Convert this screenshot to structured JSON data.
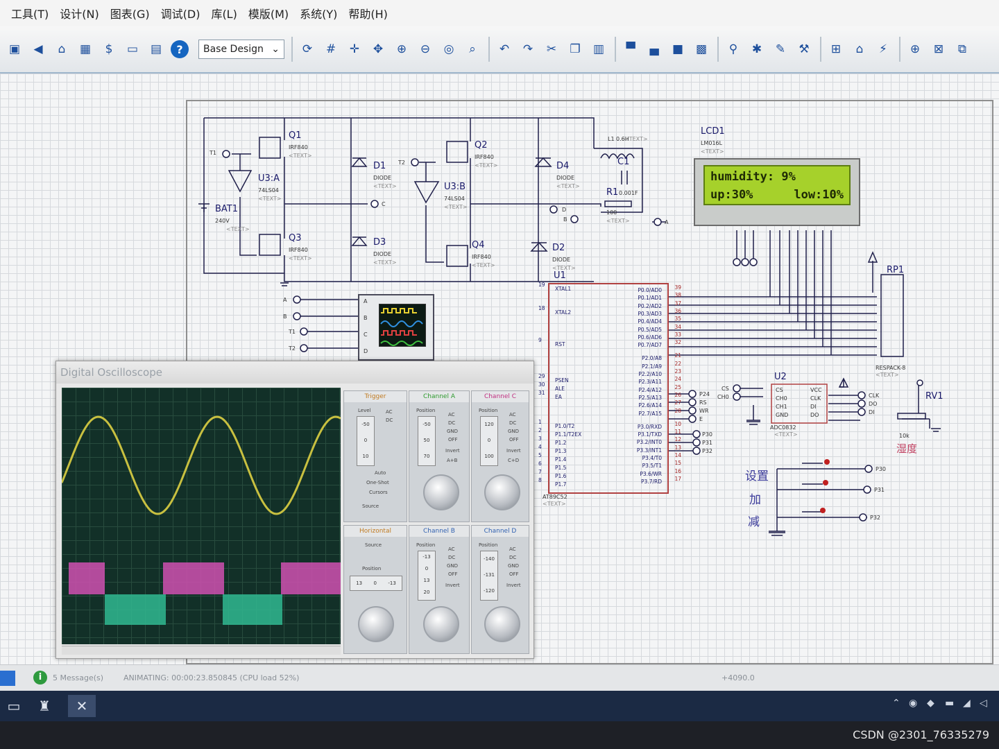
{
  "menu": {
    "items": [
      "工具(T)",
      "设计(N)",
      "图表(G)",
      "调试(D)",
      "库(L)",
      "模版(M)",
      "系统(Y)",
      "帮助(H)"
    ]
  },
  "toolbar": {
    "design_select": "Base Design",
    "icons": [
      "chip-icon",
      "back-icon",
      "component-icon",
      "pcb-icon",
      "bom-icon",
      "netlist-icon",
      "file-icon",
      "help-icon",
      "refresh-icon",
      "grid-icon",
      "origin-icon",
      "pan-icon",
      "zoom-in-icon",
      "zoom-out-icon",
      "zoom-all-icon",
      "zoom-area-icon",
      "undo-icon",
      "redo-icon",
      "cut-icon",
      "copy-icon",
      "paste-icon",
      "block-copy-icon",
      "block-move-icon",
      "block-rotate-icon",
      "block-delete-icon",
      "pick-icon",
      "make-device-icon",
      "packaging-icon",
      "decompose-icon",
      "wire-autorouter-icon",
      "search-icon",
      "property-icon",
      "new-sheet-icon",
      "remove-sheet-icon",
      "parent-sheet-icon"
    ]
  },
  "schematic": {
    "q1": {
      "name": "Q1",
      "part": "IRF840",
      "text": "<TEXT>"
    },
    "q2": {
      "name": "Q2",
      "part": "IRF840",
      "text": "<TEXT>"
    },
    "q3": {
      "name": "Q3",
      "part": "IRF840",
      "text": "<TEXT>"
    },
    "q4": {
      "name": "Q4",
      "part": "IRF840",
      "text": "<TEXT>"
    },
    "d1": {
      "name": "D1",
      "part": "DIODE",
      "text": "<TEXT>"
    },
    "d2": {
      "name": "D2",
      "part": "DIODE",
      "text": "<TEXT>"
    },
    "d3": {
      "name": "D3",
      "part": "DIODE",
      "text": "<TEXT>"
    },
    "d4": {
      "name": "D4",
      "part": "DIODE",
      "text": "<TEXT>"
    },
    "u3a": {
      "name": "U3:A",
      "part": "74LS04",
      "text": "<TEXT>"
    },
    "u3b": {
      "name": "U3:B",
      "part": "74LS04",
      "text": "<TEXT>"
    },
    "bat": {
      "name": "BAT1",
      "value": "240V",
      "text": "<TEXT>"
    },
    "l1": {
      "name": "L1",
      "value": "0.6H",
      "text": "<TEXT>"
    },
    "c1": {
      "name": "C1",
      "value": "0.001F"
    },
    "r1": {
      "name": "R1",
      "value": "100",
      "text": "<TEXT>"
    },
    "terminals": {
      "t1": "T1",
      "t2": "T2",
      "a": "A",
      "b": "B",
      "c": "C",
      "d": "D"
    },
    "scope_inputs": [
      "A",
      "B",
      "T1",
      "T2"
    ],
    "scope_channels": [
      "A",
      "B",
      "C",
      "D"
    ],
    "lcd": {
      "name": "LCD1",
      "part": "LM016L",
      "text": "<TEXT>",
      "line1": "humidity: 9%",
      "line2_left": "up:30%",
      "line2_right": "low:10%"
    },
    "u1": {
      "name": "U1",
      "part": "AT89C52",
      "text": "<TEXT>",
      "left_pins": [
        "XTAL1",
        "XTAL2",
        "RST",
        "PSEN",
        "ALE",
        "EA",
        "P1.0/T2",
        "P1.1/T2EX",
        "P1.2",
        "P1.3",
        "P1.4",
        "P1.5",
        "P1.6",
        "P1.7"
      ],
      "left_numbers": [
        "19",
        "18",
        "9",
        "29",
        "30",
        "31",
        "1",
        "2",
        "3",
        "4",
        "5",
        "6",
        "7",
        "8"
      ],
      "right_pins": [
        "P0.0/AD0",
        "P0.1/AD1",
        "P0.2/AD2",
        "P0.3/AD3",
        "P0.4/AD4",
        "P0.5/AD5",
        "P0.6/AD6",
        "P0.7/AD7",
        "P2.0/A8",
        "P2.1/A9",
        "P2.2/A10",
        "P2.3/A11",
        "P2.4/A12",
        "P2.5/A13",
        "P2.6/A14",
        "P2.7/A15",
        "P3.0/RXD",
        "P3.1/TXD",
        "P3.2/INT0",
        "P3.3/INT1",
        "P3.4/T0",
        "P3.5/T1",
        "P3.6/WR",
        "P3.7/RD"
      ],
      "right_numbers": [
        "39",
        "38",
        "37",
        "36",
        "35",
        "34",
        "33",
        "32",
        "21",
        "22",
        "23",
        "24",
        "25",
        "26",
        "27",
        "28",
        "10",
        "11",
        "12",
        "13",
        "14",
        "15",
        "16",
        "17"
      ]
    },
    "rp1": {
      "name": "RP1",
      "part": "RESPACK-8",
      "text": "<TEXT>"
    },
    "u2": {
      "name": "U2",
      "part": "ADC0832",
      "text": "<TEXT>",
      "left_pins": [
        "CS",
        "CH0",
        "CH1",
        "GND"
      ],
      "right_pins": [
        "VCC",
        "CLK",
        "DI",
        "DO"
      ],
      "net_left": [
        "CS",
        "CH0"
      ],
      "net_right": [
        "CLK",
        "DO",
        "DI"
      ]
    },
    "adc_nets": [
      "P24",
      "RS",
      "WR",
      "E"
    ],
    "port3_nets": [
      "P30",
      "P31",
      "P32"
    ],
    "rv1": {
      "name": "RV1",
      "value": "10k",
      "label": "湿度"
    },
    "buttons": [
      {
        "label": "设置",
        "net": "P30"
      },
      {
        "label": "加",
        "net": "P31"
      },
      {
        "label": "减",
        "net": "P32"
      }
    ]
  },
  "oscilloscope": {
    "title": "Digital Oscilloscope",
    "panels": {
      "trigger": {
        "title": "Trigger",
        "level": "Level",
        "values": [
          "-50",
          "0",
          "10"
        ],
        "options": [
          "AC",
          "DC",
          "Auto",
          "One-Shot",
          "Cursors",
          "Source"
        ]
      },
      "channel_a": {
        "title": "Channel A",
        "position": "Position",
        "values": [
          "-50",
          "50",
          "70"
        ],
        "modes": [
          "AC",
          "DC",
          "GND",
          "OFF",
          "Invert",
          "A+B"
        ]
      },
      "channel_c": {
        "title": "Channel C",
        "position": "Position",
        "values": [
          "120",
          "0",
          "100"
        ],
        "modes": [
          "AC",
          "DC",
          "GND",
          "OFF",
          "Invert",
          "C+D"
        ]
      },
      "horizontal": {
        "title": "Horizontal",
        "source": "Source",
        "position": "Position",
        "values": [
          "13",
          "0",
          "-13"
        ]
      },
      "channel_b": {
        "title": "Channel B",
        "position": "Position",
        "values": [
          "-13",
          "0",
          "13",
          "20"
        ],
        "modes": [
          "AC",
          "DC",
          "GND",
          "OFF",
          "Invert"
        ]
      },
      "channel_d": {
        "title": "Channel D",
        "position": "Position",
        "values": [
          "-140",
          "-131",
          "-120"
        ],
        "modes": [
          "AC",
          "DC",
          "GND",
          "OFF",
          "Invert"
        ]
      }
    },
    "traces": {
      "sine_color": "#c8c040",
      "pulse_a_color": "#d050b0",
      "pulse_b_color": "#30b890"
    }
  },
  "status": {
    "messages": "5 Message(s)",
    "animating": "ANIMATING: 00:00:23.850845 (CPU load 52%)",
    "coords": "+4090.0"
  },
  "taskbar": {
    "watermark": "CSDN @2301_76335279"
  }
}
